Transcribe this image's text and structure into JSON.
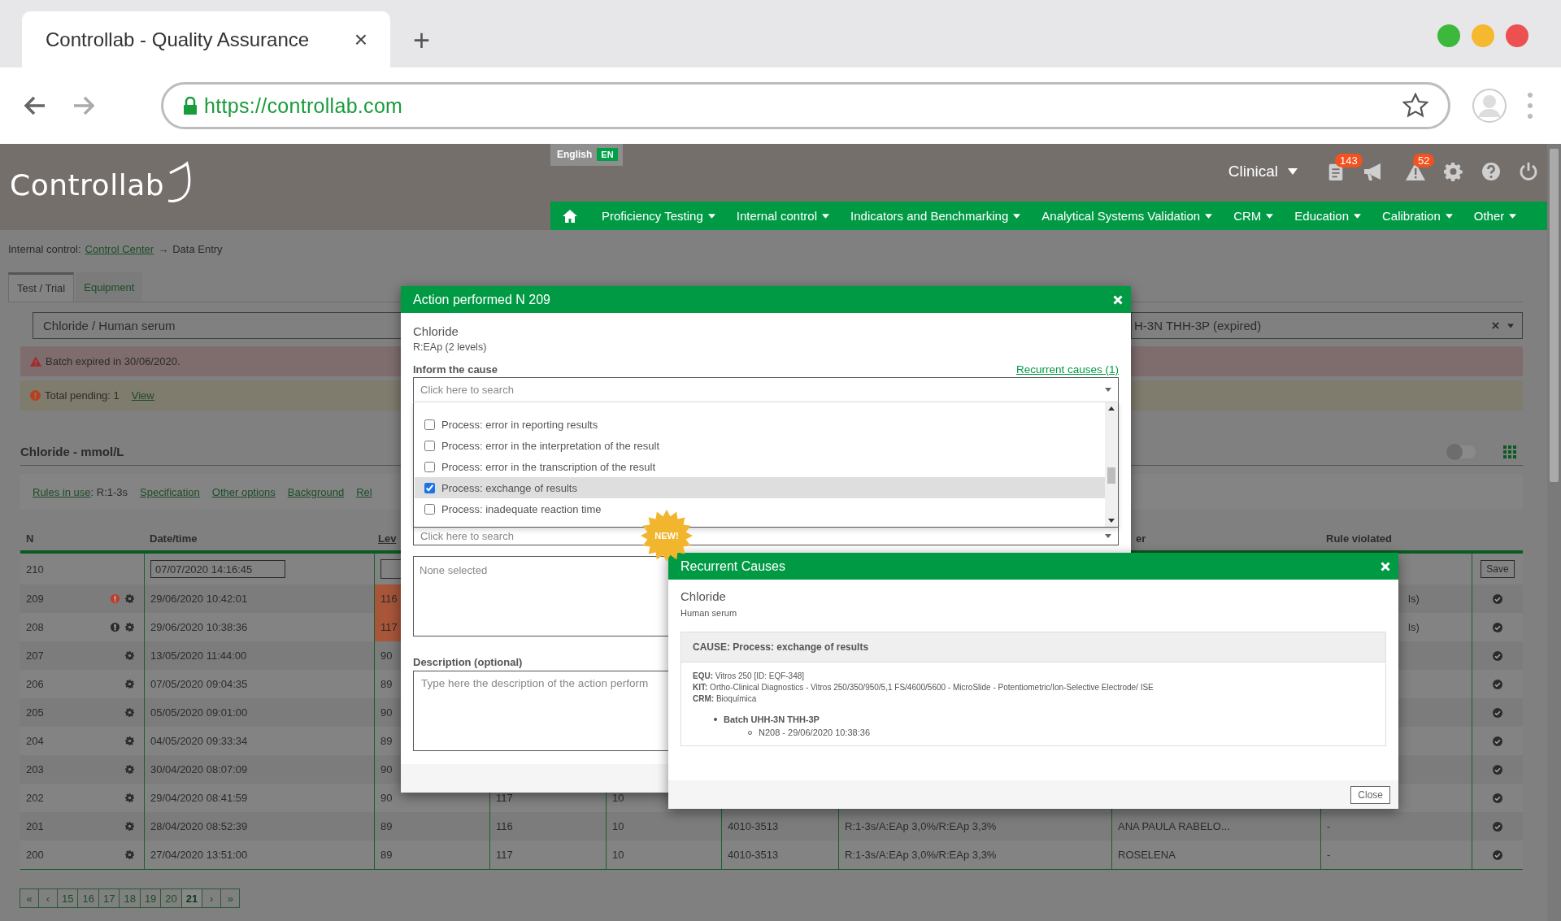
{
  "browser": {
    "tab_title": "Controllab - Quality Assurance",
    "tab_close": "×",
    "new_tab": "+",
    "url": "https://controllab.com"
  },
  "header": {
    "logo": "Controllab",
    "language": "English",
    "language_code": "EN",
    "context": "Clinical",
    "tools": [
      {
        "kind": "clipboard",
        "badge": "143"
      },
      {
        "kind": "megaphone"
      },
      {
        "kind": "warning",
        "badge": "52"
      },
      {
        "kind": "gear"
      },
      {
        "kind": "help"
      },
      {
        "kind": "power"
      }
    ]
  },
  "nav": [
    {
      "kind": "home"
    },
    {
      "kind": "menu",
      "label": "Proficiency Testing"
    },
    {
      "kind": "menu",
      "label": "Internal control"
    },
    {
      "kind": "menu",
      "label": "Indicators and Benchmarking"
    },
    {
      "kind": "menu",
      "label": "Analytical Systems Validation"
    },
    {
      "kind": "menu",
      "label": "CRM"
    },
    {
      "kind": "menu",
      "label": "Education"
    },
    {
      "kind": "menu",
      "label": "Calibration"
    },
    {
      "kind": "menu",
      "label": "Other"
    }
  ],
  "breadcrumb": {
    "section": "Internal control:",
    "link": "Control Center",
    "separator": "→",
    "current": "Data Entry"
  },
  "tabs": [
    {
      "label": "Test / Trial",
      "selected": true
    },
    {
      "label": "Equipment",
      "selected": false
    }
  ],
  "filters": {
    "analyte": "Chloride / Human serum",
    "batch": "H-3N THH-3P (expired)"
  },
  "alerts": [
    {
      "kind": "danger",
      "text": "Batch expired in 30/06/2020."
    },
    {
      "kind": "warning",
      "text": "Total pending: 1",
      "link": "View"
    }
  ],
  "section": {
    "title": "Chloride - mmol/L",
    "toggle_on": false
  },
  "links": [
    {
      "label": "Rules in use",
      "note": ": R:1-3s"
    },
    {
      "label": "Specification"
    },
    {
      "label": "Other options"
    },
    {
      "label": "Background"
    },
    {
      "label": "Rel"
    }
  ],
  "table": {
    "headers": {
      "n": "N",
      "datetime": "Date/time",
      "level": "Lev",
      "column_8": "er",
      "rule": "Rule violated"
    },
    "rows": [
      {
        "kind": "entry",
        "n": "210",
        "datetime": "07/07/2020 14:16:45",
        "action": "Save"
      },
      {
        "kind": "data",
        "n": "209",
        "color": "#c0392b",
        "datetime": "29/06/2020 10:42:01",
        "level": "116",
        "out_of_range": true,
        "rule_tail": "ls)"
      },
      {
        "kind": "data",
        "n": "208",
        "color": "#2b2b2b",
        "datetime": "29/06/2020 10:38:36",
        "level": "117",
        "out_of_range": true,
        "rule_tail": "ls)"
      },
      {
        "kind": "data",
        "n": "207",
        "datetime": "13/05/2020 11:44:00",
        "level": "90",
        "out_of_range": false
      },
      {
        "kind": "data",
        "n": "206",
        "datetime": "07/05/2020 09:04:35",
        "level": "89",
        "out_of_range": false
      },
      {
        "kind": "data",
        "n": "205",
        "datetime": "05/05/2020 09:01:00",
        "level": "90",
        "out_of_range": false
      },
      {
        "kind": "data",
        "n": "204",
        "datetime": "04/05/2020 09:33:34",
        "level": "89",
        "out_of_range": false
      },
      {
        "kind": "data",
        "n": "203",
        "datetime": "30/04/2020 08:07:09",
        "level": "90",
        "out_of_range": false
      },
      {
        "kind": "data",
        "n": "202",
        "datetime": "29/04/2020 08:41:59",
        "level": "90",
        "out_of_range": false,
        "column_4": "117",
        "column_5": "10"
      },
      {
        "kind": "data",
        "n": "201",
        "datetime": "28/04/2020 08:52:39",
        "level": "89",
        "out_of_range": false,
        "column_4": "116",
        "column_5": "10",
        "column_6": "4010-3513",
        "column_7": "R:1-3s/A:EAp 3,0%/R:EAp 3,3%",
        "column_8": "ANA PAULA RABELO...",
        "rule": "-"
      },
      {
        "kind": "data",
        "n": "200",
        "datetime": "27/04/2020 13:51:00",
        "level": "89",
        "out_of_range": false,
        "column_4": "117",
        "column_5": "10",
        "column_6": "4010-3513",
        "column_7": "R:1-3s/A:EAp 3,0%/R:EAp 3,3%",
        "column_8": "ROSELENA",
        "rule": "-"
      }
    ]
  },
  "pagination": [
    {
      "label": "«",
      "selected": false
    },
    {
      "label": "‹",
      "selected": false
    },
    {
      "label": "15",
      "selected": false
    },
    {
      "label": "16",
      "selected": false
    },
    {
      "label": "17",
      "selected": false
    },
    {
      "label": "18",
      "selected": false
    },
    {
      "label": "19",
      "selected": false
    },
    {
      "label": "20",
      "selected": false
    },
    {
      "label": "21",
      "selected": true
    },
    {
      "label": "›",
      "selected": false
    },
    {
      "label": "»",
      "selected": false
    }
  ],
  "action_modal": {
    "title": "Action performed N 209",
    "analyte": "Chloride",
    "rule": "R:EAp (2 levels)",
    "cause_label": "Inform the cause",
    "recurrent_link": "Recurrent causes (1)",
    "search_placeholder": "Click here to search",
    "options": [
      {
        "label": "Process: error in reporting results",
        "checked": false,
        "selected": false
      },
      {
        "label": "Process: error in the interpretation of the result",
        "checked": false,
        "selected": false
      },
      {
        "label": "Process: error in the transcription of the result",
        "checked": false,
        "selected": false
      },
      {
        "label": "Process: exchange of results",
        "checked": true,
        "selected": true
      },
      {
        "label": "Process: inadequate reaction time",
        "checked": false,
        "selected": false
      }
    ],
    "second_placeholder": "Click here to search",
    "selection_placeholder": "None selected",
    "description_label": "Description (optional)",
    "description_placeholder": "Type here the description of the action perform",
    "new_badge": "NEW!"
  },
  "recurrent_modal": {
    "title": "Recurrent Causes",
    "analyte": "Chloride",
    "matrix": "Human serum",
    "cause": "CAUSE: Process: exchange of results",
    "details": [
      "**EQU:** Vitros 250 [ID: EQF-348]",
      "**KIT:** Ortho-Clinical Diagnostics - Vitros 250/350/950/5,1 FS/4600/5600 - MicroSlide - Potentiometric/Ion-Selective Electrode/ ISE",
      "**CRM:** Bioquímica"
    ],
    "batch": "Batch UHH-3N THH-3P",
    "occurrence": "N208 - 29/06/2020 10:38:36",
    "close": "Close"
  }
}
